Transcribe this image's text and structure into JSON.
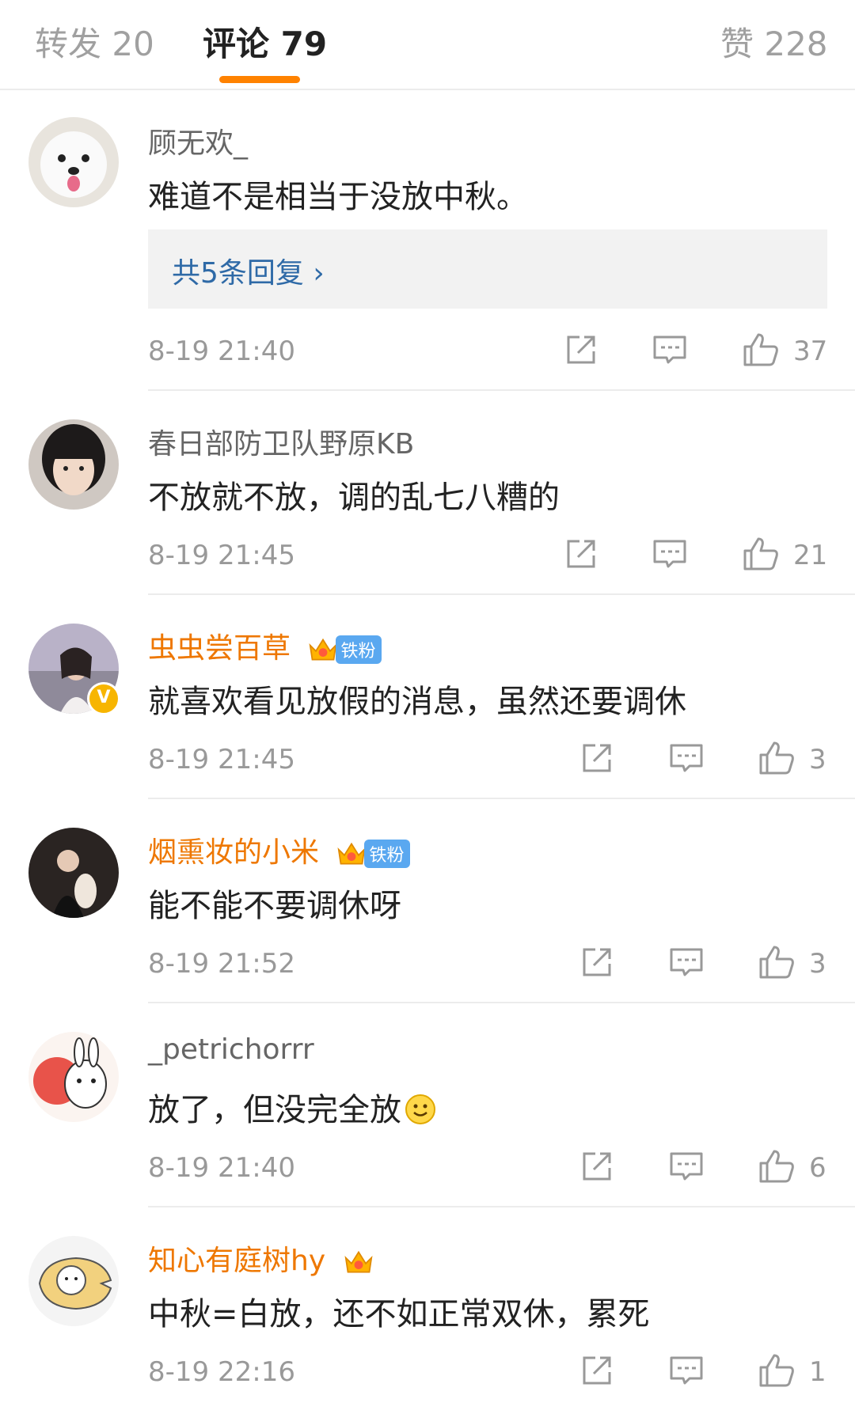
{
  "tabs": [
    {
      "label": "转发 20"
    },
    {
      "label": "评论 79"
    },
    {
      "label": "赞 228"
    }
  ],
  "accent_color": "#ff8200",
  "vip_name_color": "#ee7700",
  "link_color": "#2f6aa7",
  "comments": [
    {
      "user": "顾无欢_",
      "text": "难道不是相当于没放中秋。",
      "replies_label": "共5条回复 ›",
      "time": "8-19 21:40",
      "likes": "37"
    },
    {
      "user": "春日部防卫队野原KB",
      "text": "不放就不放，调的乱七八糟的",
      "time": "8-19 21:45",
      "likes": "21"
    },
    {
      "user": "虫虫尝百草",
      "badge_label": "铁粉",
      "text": "就喜欢看见放假的消息，虽然还要调休",
      "time": "8-19 21:45",
      "likes": "3",
      "verified_label": "V"
    },
    {
      "user": "烟熏妆的小米",
      "badge_label": "铁粉",
      "text": "能不能不要调休呀",
      "time": "8-19 21:52",
      "likes": "3"
    },
    {
      "user": "_petrichorrr",
      "text": "放了，但没完全放",
      "time": "8-19 21:40",
      "likes": "6"
    },
    {
      "user": "知心有庭树hy",
      "text": "中秋=白放，还不如正常双休，累死",
      "time": "8-19 22:16",
      "likes": "1"
    }
  ],
  "icons": {
    "forward": "share-icon",
    "comment": "comment-icon",
    "like": "like-icon",
    "emoji": "smile-emoji-icon",
    "crown": "crown-badge-icon"
  }
}
